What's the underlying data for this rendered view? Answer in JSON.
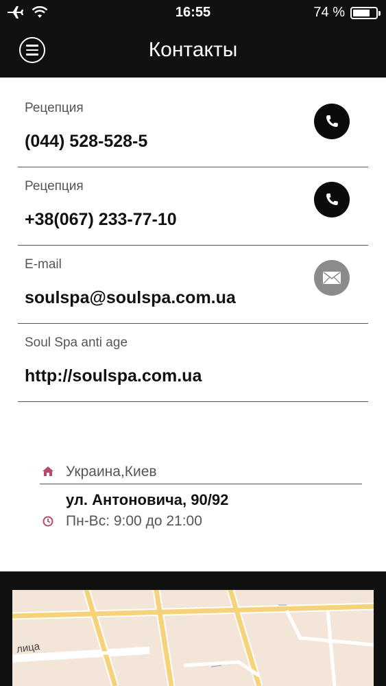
{
  "status_bar": {
    "time": "16:55",
    "battery_percent_text": "74 %",
    "battery_level": 0.74,
    "icons": [
      "airplane-icon",
      "wifi-icon",
      "battery-icon"
    ]
  },
  "header": {
    "title": "Контакты",
    "menu_icon": "menu-icon"
  },
  "contacts": [
    {
      "label": "Рецепция",
      "value": "(044) 528-528-5",
      "icon": "phone-icon"
    },
    {
      "label": "Рецепция",
      "value": "+38(067) 233-77-10",
      "icon": "phone-icon"
    },
    {
      "label": "E-mail",
      "value": "soulspa@soulspa.com.ua",
      "icon": "mail-icon"
    },
    {
      "label": "Soul Spa anti age",
      "value": "http://soulspa.com.ua",
      "icon": ""
    }
  ],
  "address": {
    "city": "Украина,Киев",
    "street": "ул. Антоновича, 90/92",
    "hours": "Пн-Вс: 9:00 до 21:00",
    "home_icon": "home-icon",
    "clock_icon": "clock-icon"
  },
  "map": {
    "street_fragment": "лица"
  },
  "colors": {
    "header_bg": "#111111",
    "accent": "#b54a6a",
    "icon_dark": "#0b0b0b",
    "icon_grey": "#8b8b8b",
    "map_bg": "#f3e6d8",
    "map_road": "#f6d27a"
  }
}
